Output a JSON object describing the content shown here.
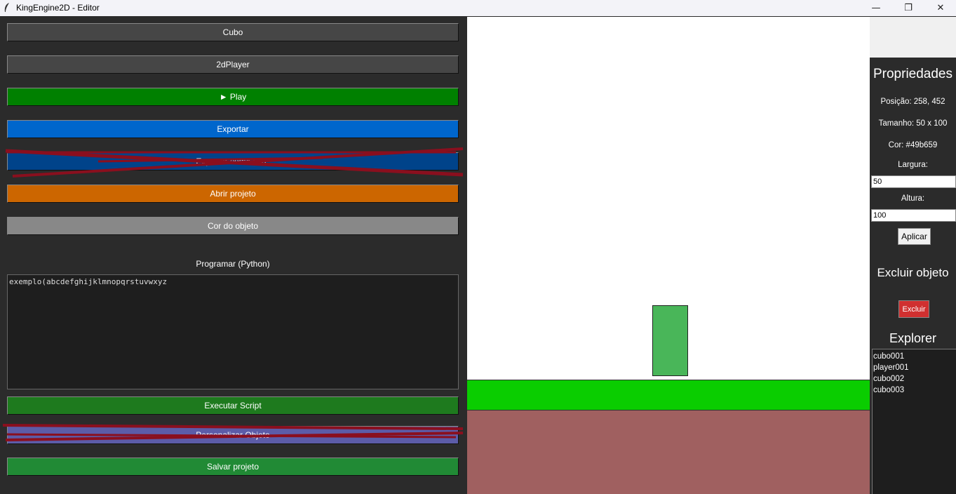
{
  "window": {
    "title": "KingEngine2D - Editor",
    "minimize_glyph": "—",
    "maximize_glyph": "❐",
    "close_glyph": "✕"
  },
  "toolbar": {
    "buttons": [
      {
        "label": "Cubo",
        "color": "#464646"
      },
      {
        "label": "2dPlayer",
        "color": "#464646"
      },
      {
        "label": "► Play",
        "color": "#008000"
      },
      {
        "label": "Exportar",
        "color": "#0066cc"
      },
      {
        "label": "Exportar como EXE",
        "color": "#00438a"
      },
      {
        "label": "Abrir projeto",
        "color": "#cc6600"
      },
      {
        "label": "Cor do objeto",
        "color": "#888888"
      }
    ]
  },
  "code": {
    "label": "Programar (Python)",
    "content": "exemplo(abcdefghijklmnopqrstuvwxyz"
  },
  "script_buttons": [
    {
      "label": "Executar Script",
      "color": "#1e7a1e"
    },
    {
      "label": "Personalizar Objeto",
      "color": "#5c5ca8"
    },
    {
      "label": "Salvar projeto",
      "color": "#218a35"
    }
  ],
  "properties": {
    "title": "Propriedades",
    "position": "Posição: 258, 452",
    "size": "Tamanho: 50 x 100",
    "color": "Cor: #49b659",
    "width_label": "Largura:",
    "width_value": "50",
    "height_label": "Altura:",
    "height_value": "100",
    "apply_label": "Aplicar"
  },
  "delete": {
    "title": "Excluir objeto",
    "button_label": "Excluir"
  },
  "explorer": {
    "title": "Explorer",
    "items": [
      "cubo001",
      "player001",
      "cubo002",
      "cubo003"
    ]
  },
  "scene": {
    "background_color": "#ffffff",
    "ground_color": "#0acd00",
    "dirt_color": "#a06060",
    "player_color": "#49b659"
  }
}
